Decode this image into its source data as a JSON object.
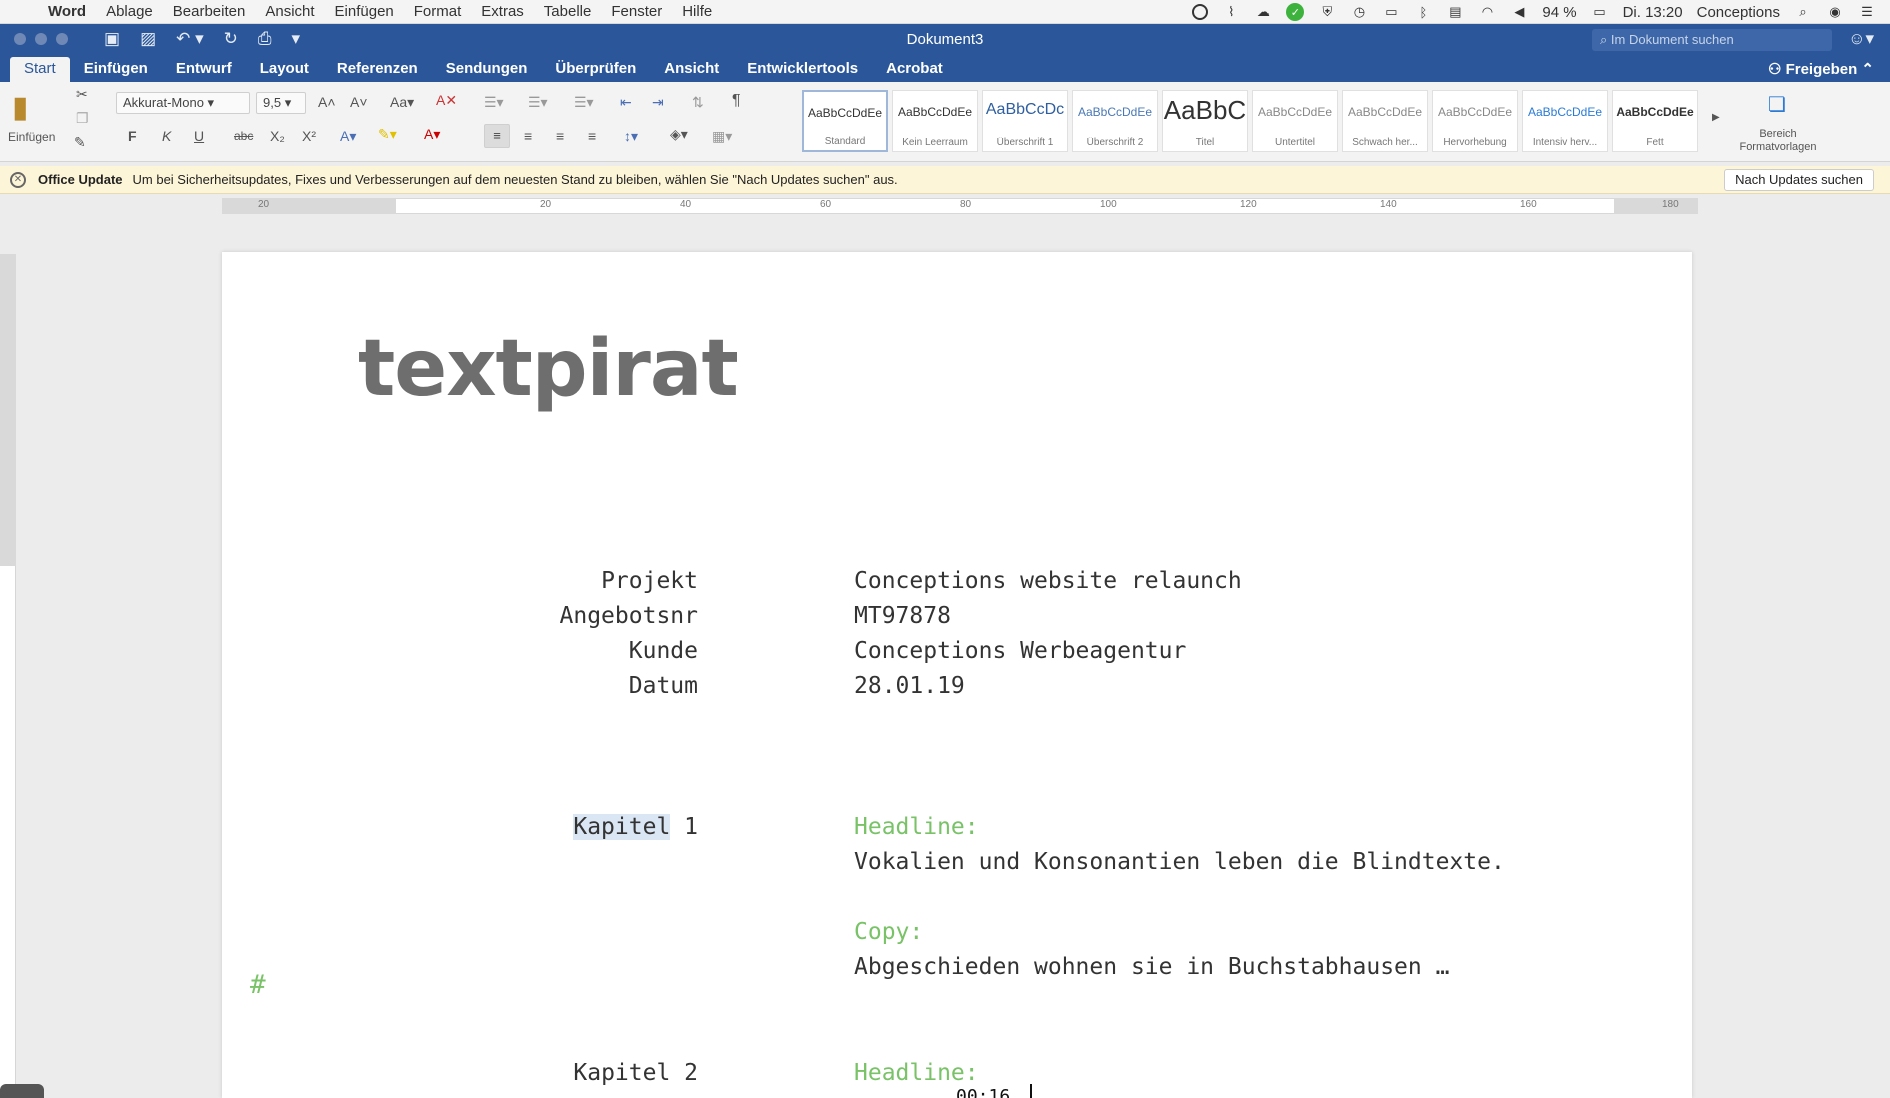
{
  "menubar": {
    "app": "Word",
    "items": [
      "Ablage",
      "Bearbeiten",
      "Ansicht",
      "Einfügen",
      "Format",
      "Extras",
      "Tabelle",
      "Fenster",
      "Hilfe"
    ],
    "battery": "94 %",
    "clock": "Di. 13:20",
    "user": "Conceptions"
  },
  "titlebar": {
    "document": "Dokument3",
    "search_placeholder": "Im Dokument suchen",
    "share": "Freigeben",
    "tabs": [
      "Start",
      "Einfügen",
      "Entwurf",
      "Layout",
      "Referenzen",
      "Sendungen",
      "Überprüfen",
      "Ansicht",
      "Entwicklertools",
      "Acrobat"
    ],
    "active_tab": "Start"
  },
  "ribbon": {
    "paste_label": "Einfügen",
    "font_name": "Akkurat-Mono",
    "font_size": "9,5",
    "bold": "F",
    "italic": "K",
    "underline": "U",
    "strike": "abc",
    "styles": [
      {
        "preview": "AaBbCcDdEe",
        "name": "Standard"
      },
      {
        "preview": "AaBbCcDdEe",
        "name": "Kein Leerraum"
      },
      {
        "preview": "AaBbCcDc",
        "name": "Überschrift 1"
      },
      {
        "preview": "AaBbCcDdEe",
        "name": "Überschrift 2"
      },
      {
        "preview": "AaBbC",
        "name": "Titel"
      },
      {
        "preview": "AaBbCcDdEe",
        "name": "Untertitel"
      },
      {
        "preview": "AaBbCcDdEe",
        "name": "Schwach her..."
      },
      {
        "preview": "AaBbCcDdEe",
        "name": "Hervorhebung"
      },
      {
        "preview": "AaBbCcDdEe",
        "name": "Intensiv herv..."
      },
      {
        "preview": "AaBbCcDdEe",
        "name": "Fett"
      }
    ],
    "styles_pane": "Bereich Formatvorlagen"
  },
  "notification": {
    "title": "Office Update",
    "message": "Um bei Sicherheitsupdates, Fixes und Verbesserungen auf dem neuesten Stand zu bleiben, wählen Sie \"Nach Updates suchen\" aus.",
    "button": "Nach Updates suchen"
  },
  "ruler": {
    "marks": [
      "20",
      "20",
      "40",
      "60",
      "80",
      "100",
      "120",
      "140",
      "160",
      "180"
    ]
  },
  "document": {
    "logo": "textpirat",
    "meta": [
      {
        "label": "Projekt",
        "value": "Conceptions website relaunch"
      },
      {
        "label": "Angebotsnr",
        "value": "MT97878"
      },
      {
        "label": "Kunde",
        "value": "Conceptions Werbeagentur"
      },
      {
        "label": "Datum",
        "value": "28.01.19"
      }
    ],
    "chapter1": {
      "label_selected": "Kapitel",
      "label_num": " 1",
      "headline_label": "Headline:",
      "headline": "Vokalien und Konsonantien leben die Blindtexte.",
      "copy_label": "Copy:",
      "copy": "Abgeschieden wohnen sie in Buchstabhausen …"
    },
    "chapter2": {
      "label": "Kapitel 2",
      "headline_label": "Headline:"
    },
    "hash": "#"
  },
  "overlay": {
    "time": "00:16"
  },
  "colors": {
    "word_blue": "#2b579a",
    "accent_green": "#79c267"
  }
}
